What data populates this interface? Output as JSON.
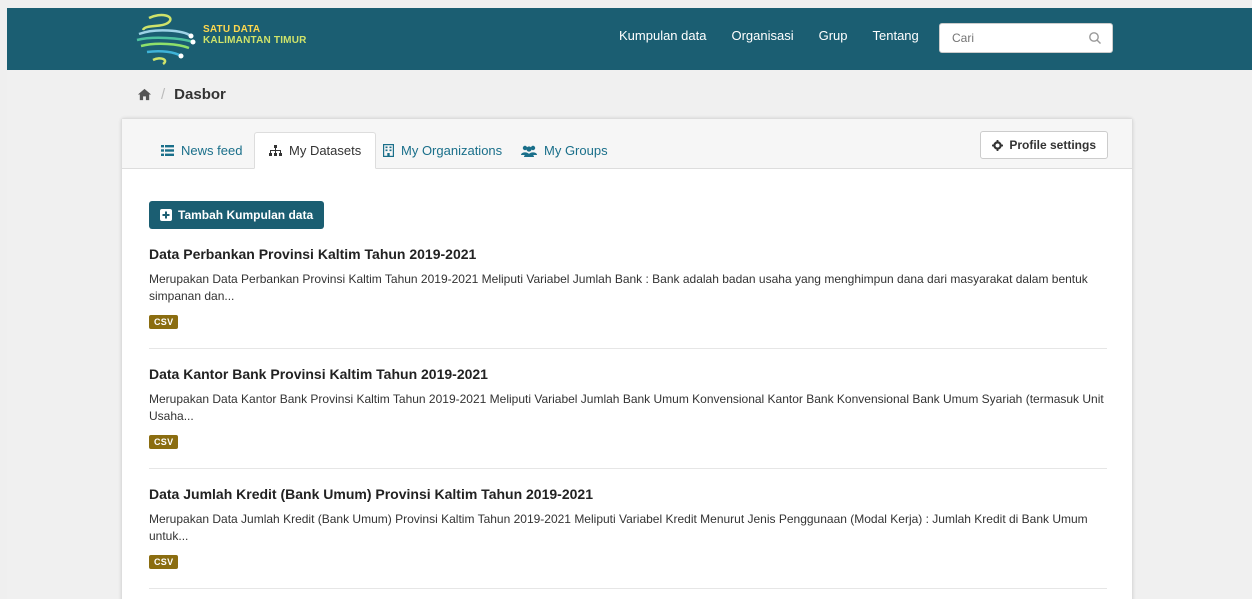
{
  "brand": {
    "line1": "SATU DATA",
    "line2": "KALIMANTAN TIMUR"
  },
  "nav": {
    "links": [
      "Kumpulan data",
      "Organisasi",
      "Grup",
      "Tentang"
    ]
  },
  "search": {
    "placeholder": "Cari",
    "value": ""
  },
  "breadcrumb": {
    "home_icon": "home-icon",
    "current": "Dasbor"
  },
  "tabs": [
    {
      "label": "News feed",
      "icon": "list-icon",
      "active": false
    },
    {
      "label": "My Datasets",
      "icon": "sitemap-icon",
      "active": true
    },
    {
      "label": "My Organizations",
      "icon": "building-icon",
      "active": false
    },
    {
      "label": "My Groups",
      "icon": "users-icon",
      "active": false
    }
  ],
  "profile_settings_label": "Profile settings",
  "add_dataset_label": "Tambah Kumpulan data",
  "datasets": [
    {
      "title": "Data Perbankan Provinsi Kaltim Tahun 2019-2021",
      "description": "Merupakan Data Perbankan Provinsi Kaltim Tahun 2019-2021 Meliputi Variabel Jumlah Bank : Bank adalah badan usaha yang menghimpun dana dari masyarakat dalam bentuk simpanan dan...",
      "format": "CSV"
    },
    {
      "title": "Data Kantor Bank Provinsi Kaltim Tahun 2019-2021",
      "description": "Merupakan Data Kantor Bank Provinsi Kaltim Tahun 2019-2021 Meliputi Variabel Jumlah Bank Umum Konvensional Kantor Bank Konvensional Bank Umum Syariah (termasuk Unit Usaha...",
      "format": "CSV"
    },
    {
      "title": "Data Jumlah Kredit (Bank Umum) Provinsi Kaltim Tahun 2019-2021",
      "description": "Merupakan Data Jumlah Kredit (Bank Umum) Provinsi Kaltim Tahun 2019-2021 Meliputi Variabel Kredit Menurut Jenis Penggunaan (Modal Kerja) : Jumlah Kredit di Bank Umum untuk...",
      "format": "CSV"
    }
  ],
  "colors": {
    "navbar": "#1b5e72",
    "primary_button": "#1b5e72",
    "link": "#1a6f8a",
    "badge": "#8b6d10"
  }
}
